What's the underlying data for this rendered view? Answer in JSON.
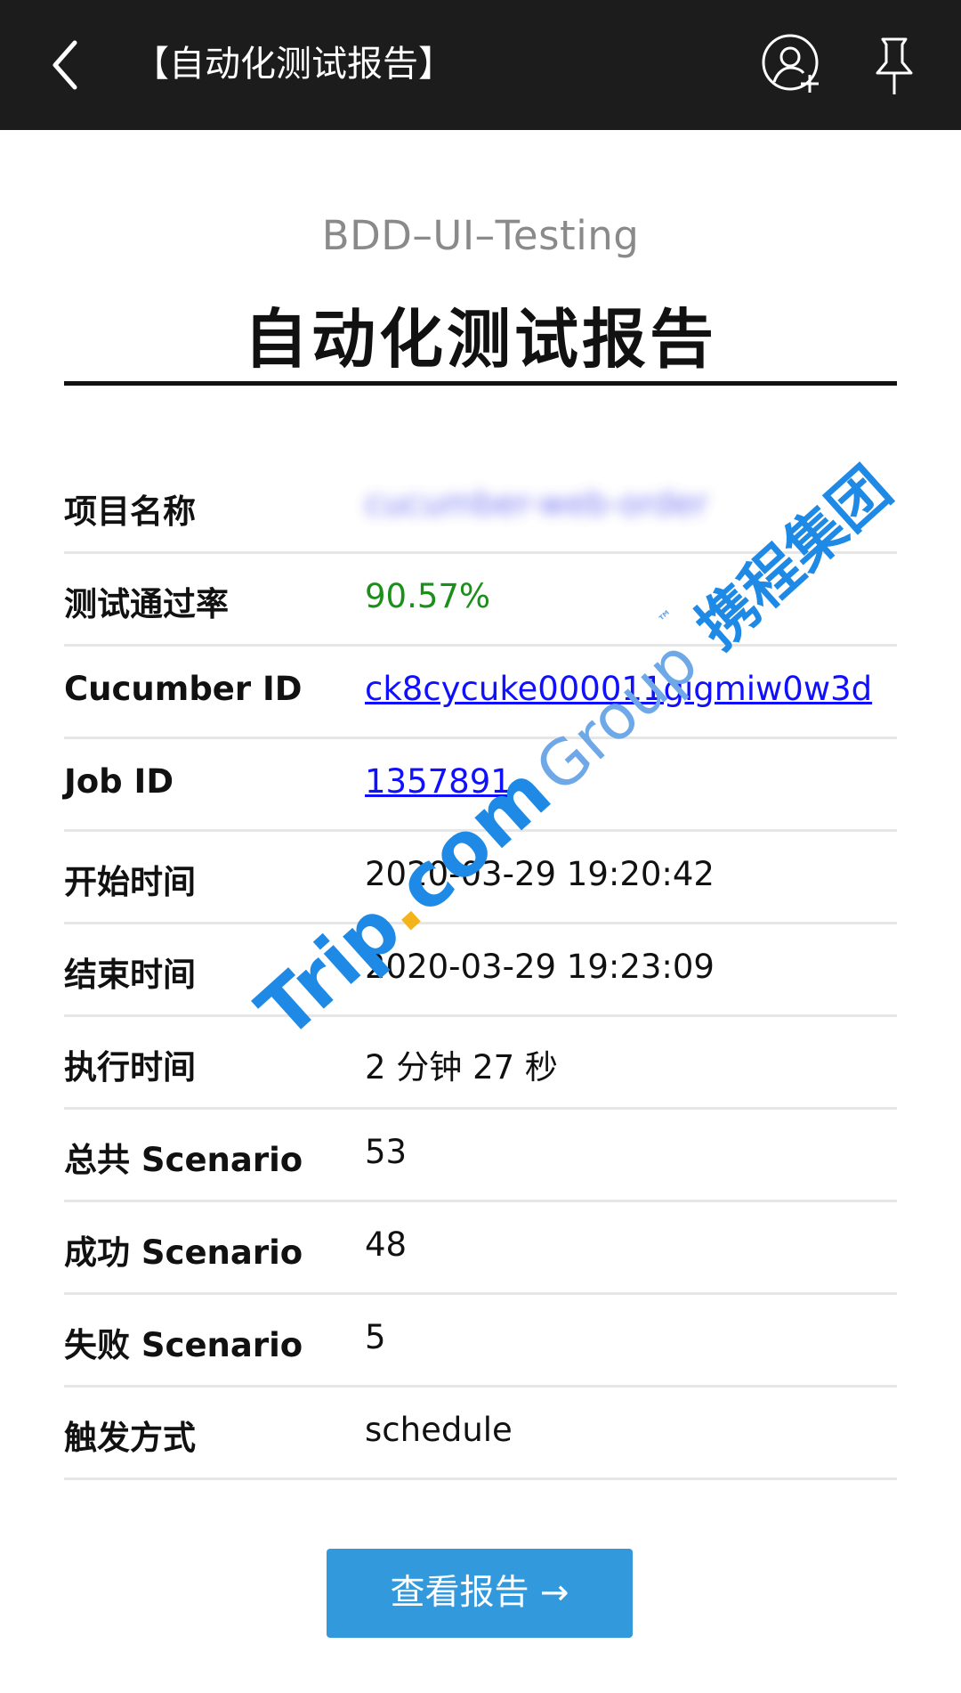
{
  "topbar": {
    "title": "【自动化测试报告】",
    "icons": {
      "back": "chevron-left-icon",
      "add_user": "add-user-icon",
      "pin": "pin-icon"
    }
  },
  "header": {
    "subtitle": "BDD–UI–Testing",
    "title": "自动化测试报告"
  },
  "rows": [
    {
      "label": "项目名称",
      "value": "cucumber-web-order"
    },
    {
      "label": "测试通过率",
      "value": "90.57%"
    },
    {
      "label": "Cucumber ID",
      "value": "ck8cycuke000011gigmiw0w3d"
    },
    {
      "label": "Job ID",
      "value": "1357891"
    },
    {
      "label": "开始时间",
      "value": "2020-03-29 19:20:42"
    },
    {
      "label": "结束时间",
      "value": "2020-03-29 19:23:09"
    },
    {
      "label": "执行时间",
      "value": "2 分钟 27 秒"
    },
    {
      "label": "总共 Scenario",
      "value": "53"
    },
    {
      "label": "成功 Scenario",
      "value": "48"
    },
    {
      "label": "失败 Scenario",
      "value": "5"
    },
    {
      "label": "触发方式",
      "value": "schedule"
    }
  ],
  "button": {
    "label": "查看报告 →"
  },
  "watermark": {
    "trip": "Trip",
    "dot": ".",
    "com": "com",
    "group": "Group",
    "tm": "™",
    "cn": "携程集团"
  },
  "colors": {
    "topbar_bg": "#1c1c1c",
    "pass_rate": "#1a8f1a",
    "link": "#1010ff",
    "button_bg": "#3399dd",
    "watermark_blue": "#1e8ae6",
    "watermark_dot": "#f3b31a"
  }
}
